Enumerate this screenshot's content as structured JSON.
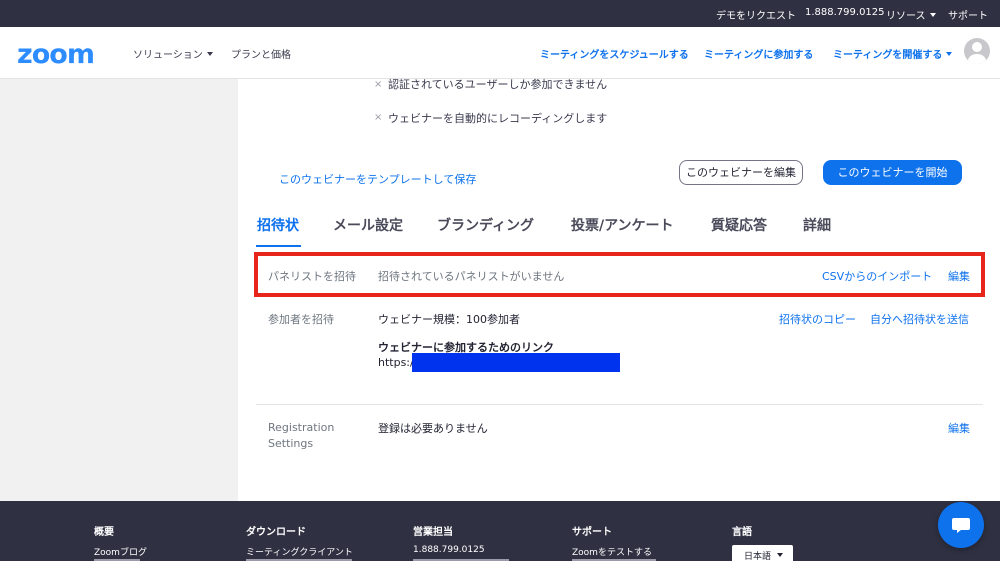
{
  "topbar": {
    "request_demo": "デモをリクエスト",
    "phone": "1.888.799.0125",
    "resources": "リソース",
    "support": "サポート"
  },
  "navbar": {
    "logo": "zoom",
    "solutions": "ソリューション",
    "plans": "プランと価格",
    "schedule": "ミーティングをスケジュールする",
    "join": "ミーティングに参加する",
    "host": "ミーティングを開催する"
  },
  "webinar": {
    "option_auth": "認証されているユーザーしか参加できません",
    "option_record": "ウェビナーを自動的にレコーディングします",
    "save_template": "このウェビナーをテンプレートして保存",
    "edit_button": "このウェビナーを編集",
    "start_button": "このウェビナーを開始"
  },
  "tabs": [
    {
      "label": "招待状"
    },
    {
      "label": "メール設定"
    },
    {
      "label": "ブランディング"
    },
    {
      "label": "投票/アンケート"
    },
    {
      "label": "質疑応答"
    },
    {
      "label": "詳細"
    }
  ],
  "panelists": {
    "label": "パネリストを招待",
    "value": "招待されているパネリストがいません",
    "csv_import": "CSVからのインポート",
    "edit": "編集"
  },
  "attendees": {
    "label": "参加者を招待",
    "size": "ウェビナー規模：100参加者",
    "copy": "招待状のコピー",
    "send_self": "自分へ招待状を送信",
    "link_title": "ウェビナーに参加するためのリンク",
    "link_prefix": "https://"
  },
  "registration": {
    "label_line1": "Registration",
    "label_line2": "Settings",
    "value": "登録は必要ありません",
    "edit": "編集"
  },
  "footer": {
    "about": "概要",
    "about_item": "Zoomブログ",
    "download": "ダウンロード",
    "download_item": "ミーティングクライアント",
    "sales": "営業担当",
    "sales_item": "1.888.799.0125",
    "support": "サポート",
    "support_item": "Zoomをテストする",
    "language": "言語",
    "language_value": "日本語"
  },
  "colors": {
    "accent": "#0e72ed",
    "highlight_border": "#e8251b",
    "topbar": "#2f3142",
    "redaction": "#0033ee"
  }
}
